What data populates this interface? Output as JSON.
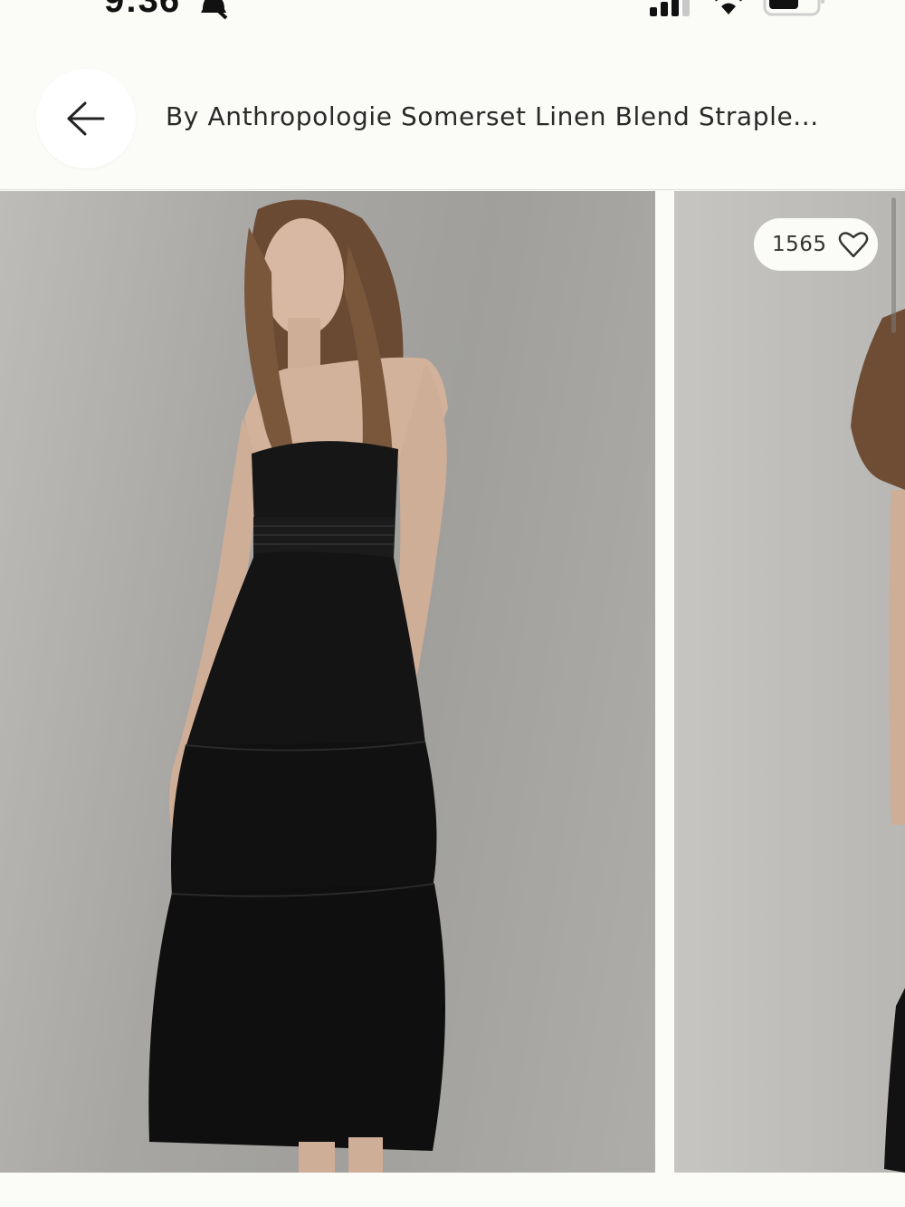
{
  "status_bar": {
    "time": "9:36",
    "icons": [
      "bell-slash-icon",
      "cellular-signal-icon",
      "wifi-icon",
      "battery-icon"
    ]
  },
  "header": {
    "back_icon": "arrow-left-icon",
    "title": "By Anthropologie Somerset Linen Blend Straple..."
  },
  "gallery": {
    "images": [
      "model-black-strapless-tiered-dress-front",
      "model-black-dress-second-view"
    ],
    "like_count": "1565",
    "like_icon": "heart-outline-icon"
  },
  "colors": {
    "background": "#fbfbf8",
    "dress": "#141414",
    "photo_backdrop": "#a9a8a5"
  }
}
